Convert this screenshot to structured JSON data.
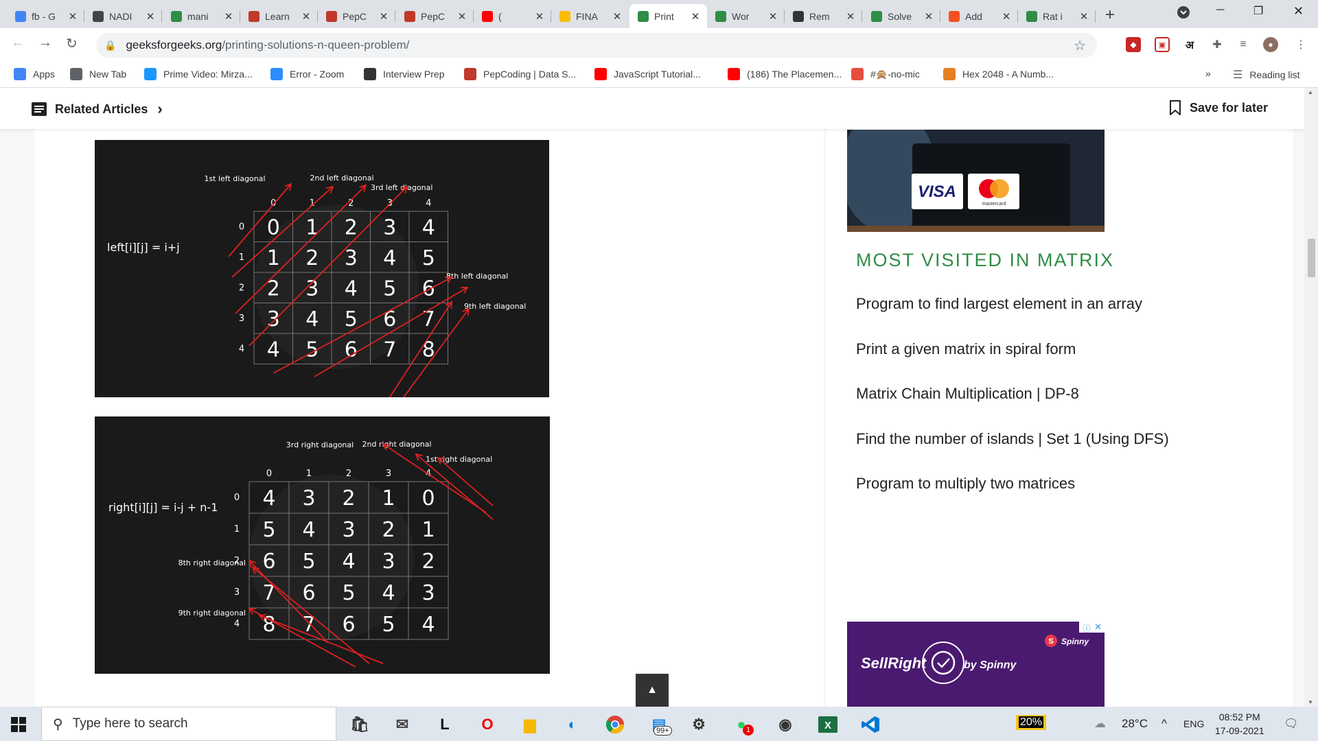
{
  "tabs": [
    {
      "title": "fb - G",
      "favicon": "google-icon",
      "color": "#4285f4"
    },
    {
      "title": "NADI",
      "favicon": "nadi-icon",
      "color": "#444"
    },
    {
      "title": "mani",
      "favicon": "gfg-icon",
      "color": "#2f8d46"
    },
    {
      "title": "Learn",
      "favicon": "pepcoding-icon",
      "color": "#c0392b"
    },
    {
      "title": "PepC",
      "favicon": "pepcoding-icon",
      "color": "#c0392b"
    },
    {
      "title": "PepC",
      "favicon": "pepcoding-icon",
      "color": "#c0392b"
    },
    {
      "title": "(",
      "favicon": "youtube-icon",
      "color": "#ff0000"
    },
    {
      "title": "FINA",
      "favicon": "drive-icon",
      "color": "#fbbc04"
    },
    {
      "title": "Print",
      "favicon": "gfg-icon",
      "color": "#2f8d46"
    },
    {
      "title": "Wor",
      "favicon": "gfg-icon",
      "color": "#2f8d46"
    },
    {
      "title": "Rem",
      "favicon": "leetcode-icon",
      "color": "#333"
    },
    {
      "title": "Solve",
      "favicon": "gfg-icon",
      "color": "#2f8d46"
    },
    {
      "title": "Add",
      "favicon": "microsoft-icon",
      "color": "#f25022"
    },
    {
      "title": "Rat i",
      "favicon": "gfg-icon",
      "color": "#2f8d46"
    }
  ],
  "address": {
    "host": "geeksforgeeks.org",
    "path": "/printing-solutions-n-queen-problem/"
  },
  "bookmarks": [
    {
      "label": "Apps",
      "icon": "apps-icon",
      "color": "#4285f4"
    },
    {
      "label": "New Tab",
      "icon": "globe-icon",
      "color": "#5f6368"
    },
    {
      "label": "Prime Video: Mirza...",
      "icon": "prime-icon",
      "color": "#1a98ff"
    },
    {
      "label": "Error - Zoom",
      "icon": "zoom-icon",
      "color": "#2d8cff"
    },
    {
      "label": "Interview Prep",
      "icon": "td-icon",
      "color": "#333"
    },
    {
      "label": "PepCoding | Data S...",
      "icon": "pepcoding-icon",
      "color": "#c0392b"
    },
    {
      "label": "JavaScript Tutorial...",
      "icon": "youtube-icon",
      "color": "#ff0000"
    },
    {
      "label": "(186) The Placemen...",
      "icon": "youtube-icon",
      "color": "#ff0000"
    },
    {
      "label": "#🙊-no-mic",
      "icon": "discord-icon",
      "color": "#e74c3c"
    },
    {
      "label": "Hex 2048 - A Numb...",
      "icon": "hex-icon",
      "color": "#e67e22"
    }
  ],
  "reading_list": "Reading list",
  "related_articles": "Related Articles",
  "save_for_later": "Save for later",
  "fig1": {
    "formula": "left[i][j] = i+j",
    "labels": [
      "1st left diagonal",
      "2nd left diagonal",
      "3rd left diagonal",
      "8th left diagonal",
      "9th left diagonal"
    ],
    "col_index": [
      "0",
      "1",
      "2",
      "3",
      "4"
    ],
    "row_index": [
      "0",
      "1",
      "2",
      "3",
      "4"
    ],
    "grid": [
      [
        "0",
        "1",
        "2",
        "3",
        "4"
      ],
      [
        "1",
        "2",
        "3",
        "4",
        "5"
      ],
      [
        "2",
        "3",
        "4",
        "5",
        "6"
      ],
      [
        "3",
        "4",
        "5",
        "6",
        "7"
      ],
      [
        "4",
        "5",
        "6",
        "7",
        "8"
      ]
    ]
  },
  "fig2": {
    "formula": "right[i][j] = i-j + n-1",
    "labels": [
      "3rd right diagonal",
      "2nd right diagonal",
      "1st right diagonal",
      "8th right diagonal",
      "9th right diagonal"
    ],
    "col_index": [
      "0",
      "1",
      "2",
      "3",
      "4"
    ],
    "row_index": [
      "0",
      "1",
      "2",
      "3",
      "4"
    ],
    "grid": [
      [
        "4",
        "3",
        "2",
        "1",
        "0"
      ],
      [
        "5",
        "4",
        "3",
        "2",
        "1"
      ],
      [
        "6",
        "5",
        "4",
        "3",
        "2"
      ],
      [
        "7",
        "6",
        "5",
        "4",
        "3"
      ],
      [
        "8",
        "7",
        "6",
        "5",
        "4"
      ]
    ]
  },
  "most_visited": {
    "title": "MOST VISITED IN MATRIX",
    "links": [
      "Program to find largest element in an array",
      "Print a given matrix in spiral form",
      "Matrix Chain Multiplication | DP-8",
      "Find the number of islands | Set 1 (Using DFS)",
      "Program to multiply two matrices"
    ]
  },
  "ad1": {
    "brand1": "VISA",
    "brand2": "mastercard"
  },
  "ad2": {
    "text": "SellRight",
    "by": "by Spinny",
    "brand": "Spinny"
  },
  "taskbar": {
    "search_placeholder": "Type here to search",
    "badge": "99+",
    "whatsapp_count": "1",
    "battery": "20%",
    "weather": "28°C",
    "lang": "ENG",
    "time": "08:52 PM",
    "date": "17-09-2021"
  }
}
